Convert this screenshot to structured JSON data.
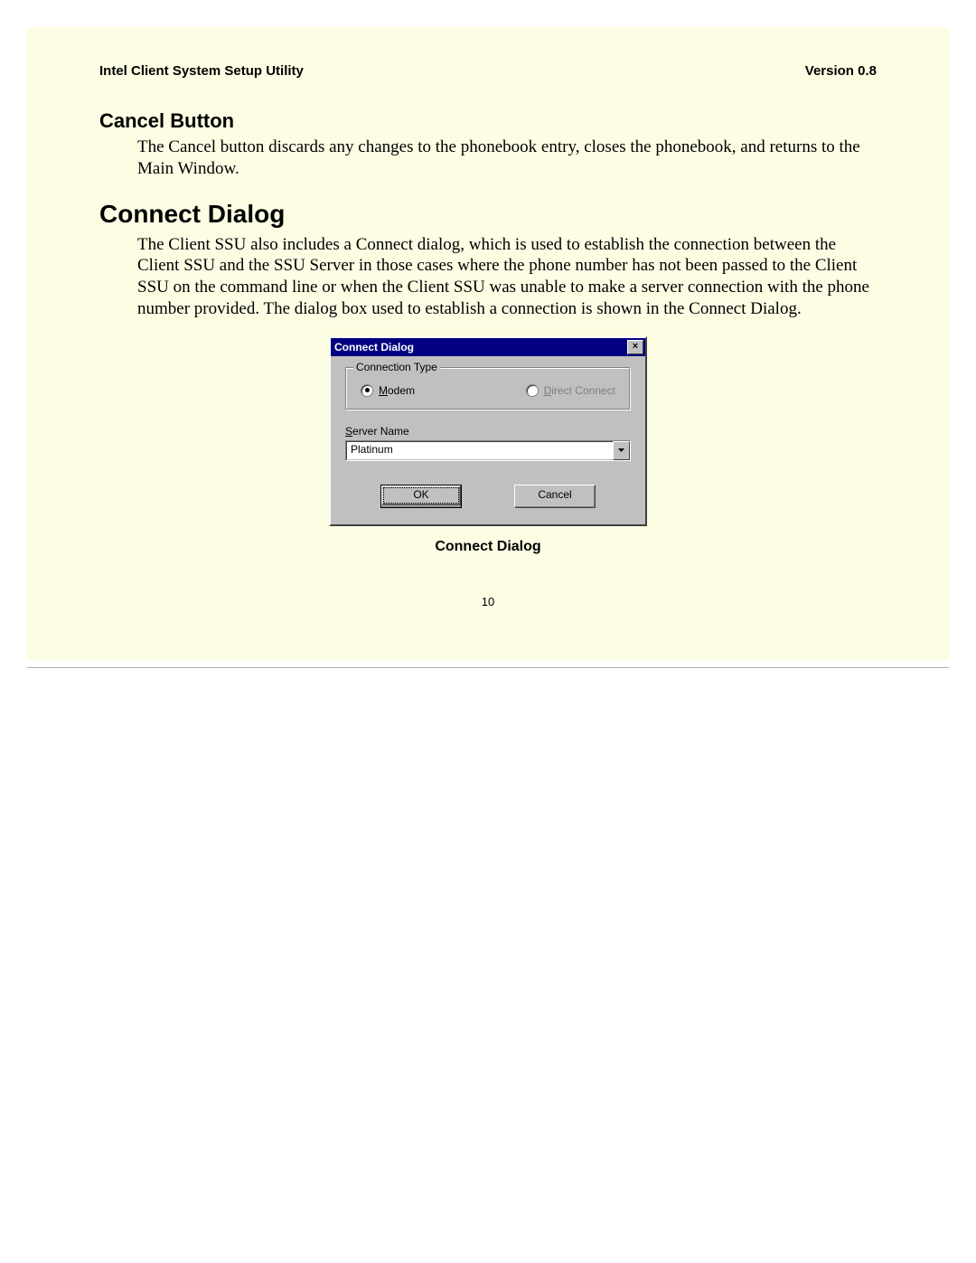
{
  "header": {
    "left": "Intel Client System Setup Utility",
    "right": "Version 0.8"
  },
  "section1": {
    "heading": "Cancel Button",
    "body": "The Cancel button discards any changes to the phonebook entry, closes the phonebook, and returns to the Main Window."
  },
  "section2": {
    "heading": "Connect Dialog",
    "body": "The Client SSU also includes a Connect dialog, which is used to establish the connection between the Client SSU and the SSU Server in those cases where the phone number has not been passed to the Client SSU on the command line or when the Client SSU was unable to make a server connection with the phone number provided.  The dialog box used to establish a connection is shown in the Connect Dialog."
  },
  "dialog": {
    "title": "Connect Dialog",
    "group_label": "Connection Type",
    "radio_modem_prefix": "M",
    "radio_modem_rest": "odem",
    "radio_direct_prefix": "D",
    "radio_direct_rest": "irect Connect",
    "server_label_prefix": "S",
    "server_label_rest": "erver Name",
    "server_value": "Platinum",
    "ok_label": "OK",
    "cancel_label": "Cancel"
  },
  "figure_caption": "Connect Dialog",
  "page_number": "10"
}
